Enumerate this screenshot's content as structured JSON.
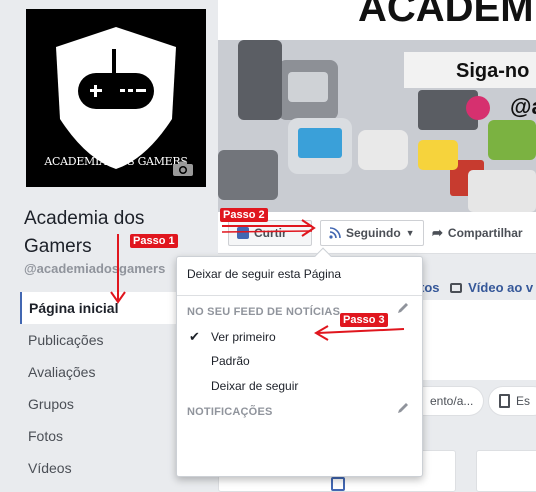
{
  "page": {
    "name": "Academia dos Gamers",
    "handle": "@academiadosgamers",
    "avatar_text": "ACADEMIA DOS GAMERS",
    "cover_text": {
      "title": "ACADEMIA",
      "follow": "Siga-no",
      "handle_peek": "@a"
    }
  },
  "sidebar": {
    "items": [
      {
        "label": "Página inicial"
      },
      {
        "label": "Publicações"
      },
      {
        "label": "Avaliações"
      },
      {
        "label": "Grupos"
      },
      {
        "label": "Fotos"
      },
      {
        "label": "Vídeos"
      }
    ]
  },
  "actions": {
    "like": "Curtir",
    "following": "Seguindo",
    "share": "Compartilhar"
  },
  "dropdown": {
    "unfollow_page": "Deixar de seguir esta Página",
    "feed_heading": "NO SEU FEED DE NOTÍCIAS",
    "see_first": "Ver primeiro",
    "default": "Padrão",
    "unfollow": "Deixar de seguir",
    "notifications_heading": "NOTIFICAÇÕES"
  },
  "peek": {
    "tab1": "tos",
    "tab2": "Vídeo ao v",
    "pill1": "ento/a...",
    "pill2": "Es"
  },
  "annotations": {
    "step1": "Passo 1",
    "step2": "Passo 2",
    "step3": "Passo 3"
  },
  "colors": {
    "accent": "#4267b2",
    "annotation": "#e0161e"
  }
}
